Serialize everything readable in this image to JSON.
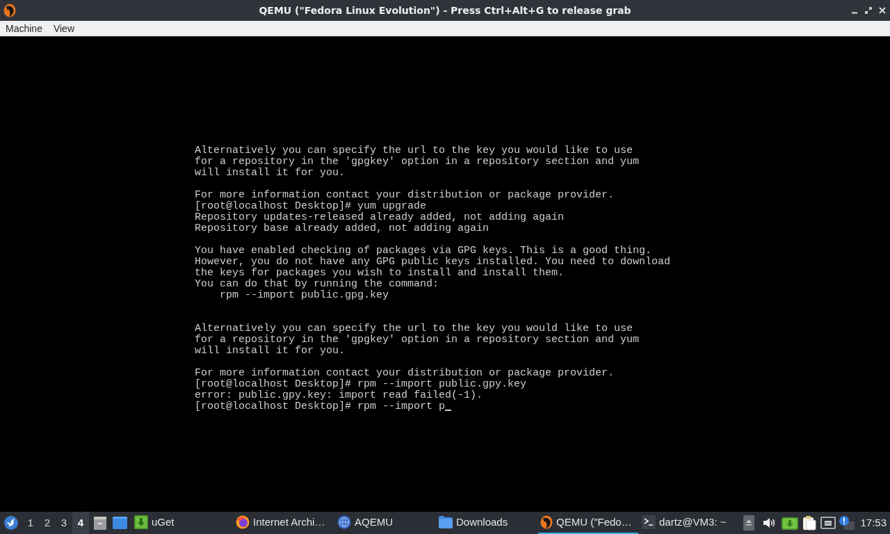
{
  "window": {
    "title": "QEMU (\"Fedora Linux Evolution\") - Press Ctrl+Alt+G to release grab"
  },
  "menu": [
    {
      "label": "Machine"
    },
    {
      "label": "View"
    }
  ],
  "terminal": {
    "lines": [
      {
        "kind": "text",
        "text": "Alternatively you can specify the url to the key you would like to use"
      },
      {
        "kind": "text",
        "text": "for a repository in the 'gpgkey' option in a repository section and yum"
      },
      {
        "kind": "text",
        "text": "will install it for you."
      },
      {
        "kind": "blank"
      },
      {
        "kind": "text",
        "text": "For more information contact your distribution or package provider."
      },
      {
        "kind": "text",
        "text": "[root@localhost Desktop]# yum upgrade"
      },
      {
        "kind": "text",
        "text": "Repository updates-released already added, not adding again"
      },
      {
        "kind": "text",
        "text": "Repository base already added, not adding again"
      },
      {
        "kind": "blank"
      },
      {
        "kind": "text",
        "text": "You have enabled checking of packages via GPG keys. This is a good thing."
      },
      {
        "kind": "text",
        "text": "However, you do not have any GPG public keys installed. You need to download"
      },
      {
        "kind": "text",
        "text": "the keys for packages you wish to install and install them."
      },
      {
        "kind": "text",
        "text": "You can do that by running the command:"
      },
      {
        "kind": "text",
        "text": "    rpm --import public.gpg.key"
      },
      {
        "kind": "blank"
      },
      {
        "kind": "blank"
      },
      {
        "kind": "text",
        "text": "Alternatively you can specify the url to the key you would like to use"
      },
      {
        "kind": "text",
        "text": "for a repository in the 'gpgkey' option in a repository section and yum"
      },
      {
        "kind": "text",
        "text": "will install it for you."
      },
      {
        "kind": "blank"
      },
      {
        "kind": "text",
        "text": "For more information contact your distribution or package provider."
      },
      {
        "kind": "text",
        "text": "[root@localhost Desktop]# rpm --import public.gpy.key"
      },
      {
        "kind": "text",
        "text": "error: public.gpy.key: import read failed(-1)."
      },
      {
        "kind": "input",
        "text": "[root@localhost Desktop]# rpm --import p"
      }
    ]
  },
  "taskbar": {
    "workspaces": [
      {
        "label": "1",
        "selected": false
      },
      {
        "label": "2",
        "selected": false
      },
      {
        "label": "3",
        "selected": false
      },
      {
        "label": "4",
        "selected": true
      }
    ],
    "tasks": [
      {
        "kind": "downloader",
        "label": "uGet",
        "selected": false
      },
      {
        "kind": "browser",
        "label": "Internet Archi…",
        "selected": false
      },
      {
        "kind": "manager",
        "label": "AQEMU",
        "selected": false
      },
      {
        "kind": "folder",
        "label": "Downloads",
        "selected": false
      },
      {
        "kind": "emulator",
        "label": "QEMU (\"Fedo…",
        "selected": true
      },
      {
        "kind": "terminal",
        "label": "dartz@VM3: ~",
        "selected": false
      }
    ],
    "clock": "17:53"
  }
}
